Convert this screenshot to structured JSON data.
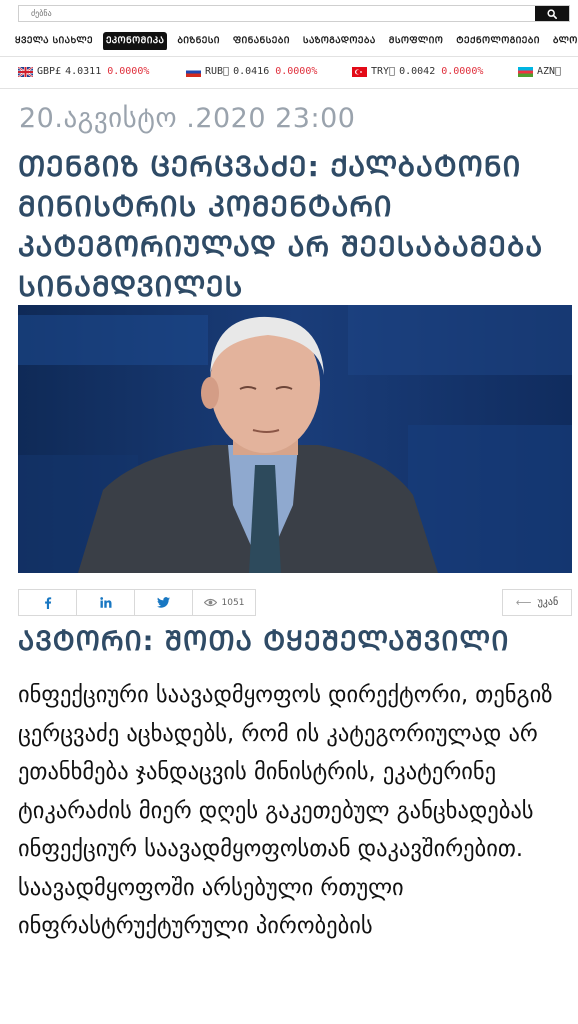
{
  "search": {
    "placeholder": "ძებნა"
  },
  "nav": {
    "items": [
      {
        "label": "ᲧᲕᲔᲚᲐ ᲡᲘᲐᲮᲚᲔ",
        "active": false
      },
      {
        "label": "ᲔᲙᲝᲜᲝᲛᲘᲙᲐ",
        "active": true
      },
      {
        "label": "ᲑᲘᲖᲜᲔᲡᲘ",
        "active": false
      },
      {
        "label": "ᲤᲘᲜᲐᲜᲡᲔᲑᲘ",
        "active": false
      },
      {
        "label": "ᲡᲐᲖᲝᲒᲐᲓᲝᲔᲑᲐ",
        "active": false
      },
      {
        "label": "ᲛᲡᲝᲤᲚᲘᲝ",
        "active": false
      },
      {
        "label": "ᲢᲔᲥᲜᲝᲚᲝᲒᲘᲔᲑᲘ",
        "active": false
      },
      {
        "label": "ᲑᲚᲝᲒᲘ",
        "active": false
      }
    ]
  },
  "ticker": [
    {
      "flag": "uk-flag-icon",
      "code": "GBP£",
      "rate": "4.0311",
      "change": "0.0000%"
    },
    {
      "flag": "russia-flag-icon",
      "code": "RUB⃣",
      "rate": "0.0416",
      "change": "0.0000%"
    },
    {
      "flag": "turkey-flag-icon",
      "code": "TRY⃣",
      "rate": "0.0042",
      "change": "0.0000%"
    },
    {
      "flag": "azerbaijan-flag-icon",
      "code": "AZN⃣",
      "rate": "",
      "change": ""
    }
  ],
  "article": {
    "date": "20.აგვისტო .2020 23:00",
    "title": "ᲗᲔᲜᲒᲘᲖ ᲪᲔᲠᲪᲕᲐᲫᲔ: ᲥᲐᲚᲑᲐᲢᲝᲜᲘ ᲛᲘᲜᲘᲡᲢᲠᲘᲡ ᲙᲝᲛᲔᲜᲢᲐᲠᲘ ᲙᲐᲢᲔᲒᲝᲠᲘᲣᲚᲐᲓ ᲐᲠ ᲨᲔᲔᲡᲐᲑᲐᲛᲔᲑᲐ ᲡᲘᲜᲐᲛᲓᲕᲘᲚᲔᲡ",
    "views": "1051",
    "back_label": "უკან",
    "author": "ᲐᲕᲢᲝᲠᲘ: ᲨᲝᲗᲐ ᲢᲧᲔᲨᲔᲚᲐᲨᲕᲘᲚᲘ",
    "body": "ინფექციური საავადმყოფოს დირექტორი, თენგიზ ცერცვაძე აცხადებს, რომ ის კატეგორიულად არ ეთანხმება ჯანდაცვის მინისტრის, ეკატერინე ტიკარაძის მიერ დღეს გაკეთებულ განცხადებას ინფექციურ საავადმყოფოსთან დაკავშირებით. საავადმყოფოში არსებული რთული ინფრასტრუქტურული პირობების"
  },
  "share": {
    "facebook_icon": "facebook-icon",
    "linkedin_icon": "linkedin-icon",
    "twitter_icon": "twitter-icon",
    "views_icon": "eye-icon"
  },
  "colors": {
    "heading": "#2f4b66",
    "date": "#9aa3ad",
    "change_red": "#e0303c",
    "share_blue": "#1877c2"
  }
}
